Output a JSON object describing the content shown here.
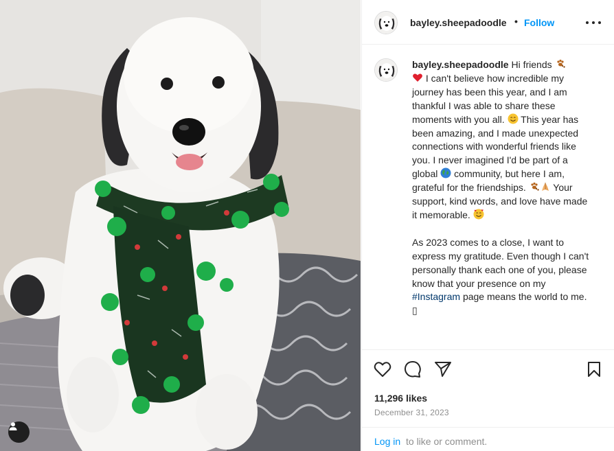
{
  "post": {
    "username": "bayley.sheepadoodle",
    "separator": "•",
    "follow_label": "Follow",
    "caption": {
      "username": "bayley.sheepadoodle",
      "p1_a": "Hi friends",
      "p1_b": "I can't believe how incredible my journey has been this year, and I am thankful I was able to share these moments with you all.",
      "p1_c": "This year has been amazing, and I made unexpected connections with wonderful friends like you. I never imagined I'd be part of a global",
      "p1_d": "community, but here I am, grateful for the friendships.",
      "p1_e": "Your support, kind words, and love have made it memorable.",
      "p2_a": "As 2023 comes to a close, I want to express my gratitude. Even though I can't personally thank each one of you, please know that your presence on my",
      "hashtag": "#Instagram",
      "p2_b": "page means the world to me.",
      "trailing_glyph": "▯"
    },
    "likes": "11,296 likes",
    "date": "December 31, 2023",
    "login_label": "Log in",
    "login_rest": "to like or comment."
  },
  "icons": {
    "more": "more-options-icon",
    "like": "heart-icon",
    "comment": "comment-icon",
    "share": "share-icon",
    "save": "bookmark-icon",
    "tag": "user-tag-icon",
    "emoji_paws": "paw-prints-emoji",
    "emoji_heart": "red-heart-emoji",
    "emoji_smile": "smiling-face-emoji",
    "emoji_globe": "globe-emoji",
    "emoji_pray": "folded-hands-emoji",
    "emoji_hearts_face": "smiling-face-with-hearts-emoji"
  },
  "colors": {
    "accent": "#0095f6",
    "hashtag": "#00376b",
    "text": "#262626",
    "muted": "#8e8e8e"
  }
}
